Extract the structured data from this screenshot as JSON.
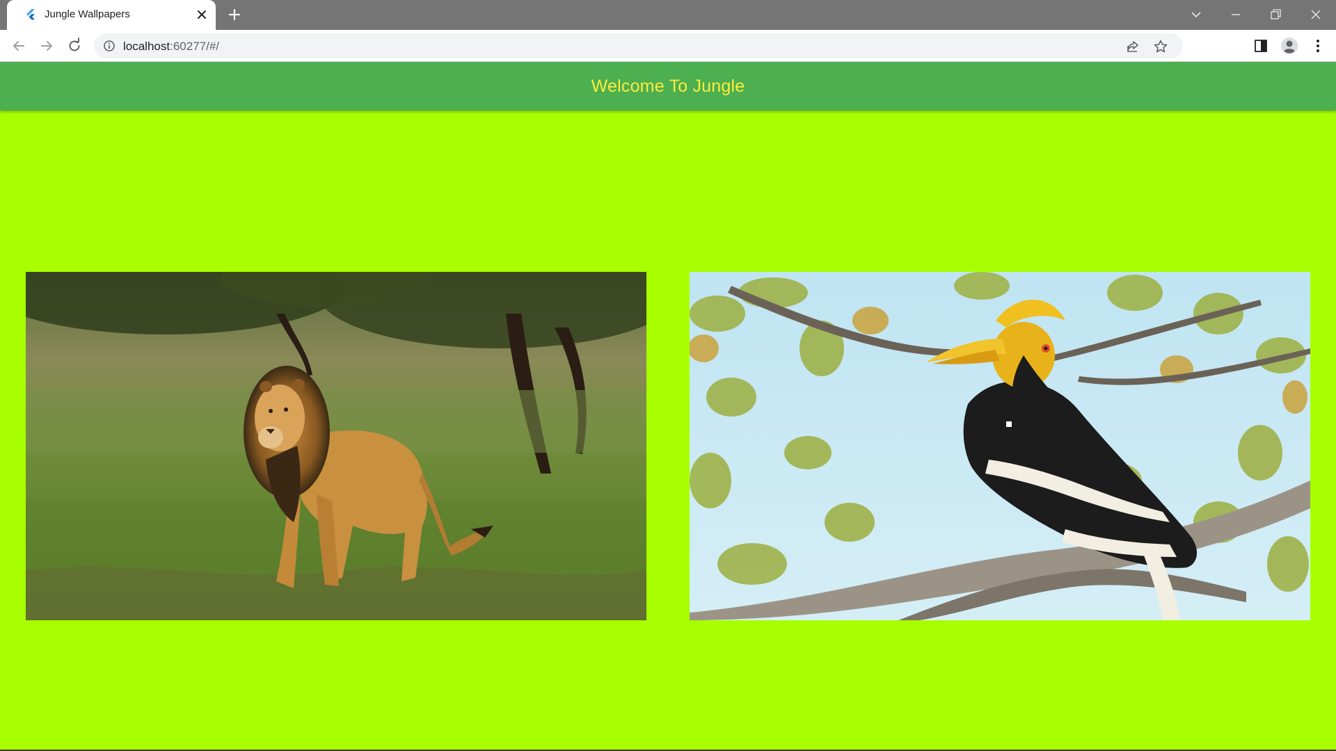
{
  "browser": {
    "tab": {
      "title": "Jungle Wallpapers",
      "favicon": "flutter-logo-icon"
    },
    "address_bar": {
      "host": "localhost",
      "path": ":60277/#/"
    },
    "icons": {
      "back": "back-arrow-icon",
      "forward": "forward-arrow-icon",
      "reload": "reload-icon",
      "site_info": "info-icon",
      "share": "share-icon",
      "bookmark": "star-icon",
      "side_panel": "side-panel-icon",
      "profile": "profile-avatar-icon",
      "menu": "kebab-menu-icon"
    }
  },
  "app": {
    "title": "Welcome To Jungle",
    "colors": {
      "appbar_bg": "#4caf50",
      "title_color": "#ffeb3b",
      "page_bg": "#a8ff00"
    },
    "wallpapers": [
      {
        "subject": "lion"
      },
      {
        "subject": "hornbill"
      }
    ]
  }
}
